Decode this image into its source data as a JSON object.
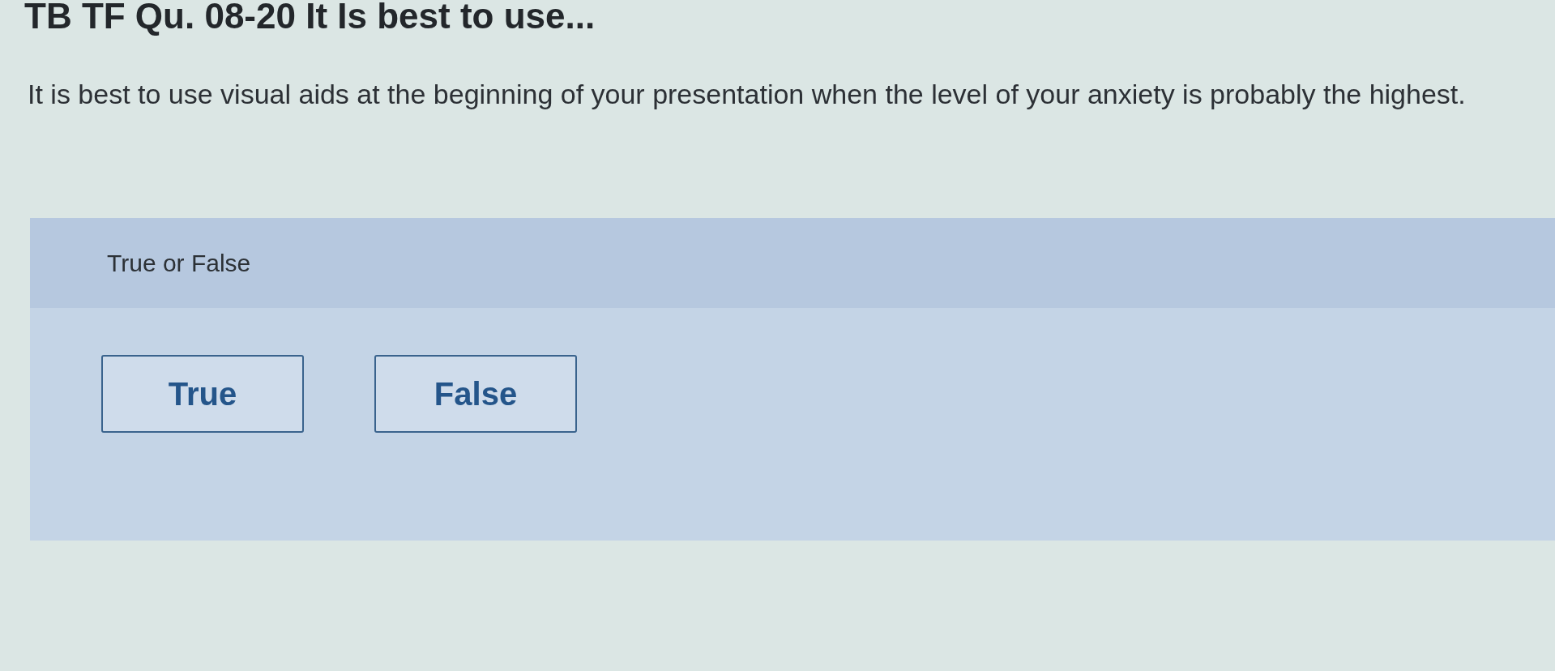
{
  "page": {
    "title": "TB TF Qu. 08-20 It Is best to use..."
  },
  "question": {
    "text": "It is best to use visual aids at the beginning of your presentation when the level of your anxiety is probably the highest."
  },
  "answer_panel": {
    "label": "True or False",
    "options": [
      {
        "label": "True",
        "selected": false
      },
      {
        "label": "False",
        "selected": false
      }
    ]
  }
}
